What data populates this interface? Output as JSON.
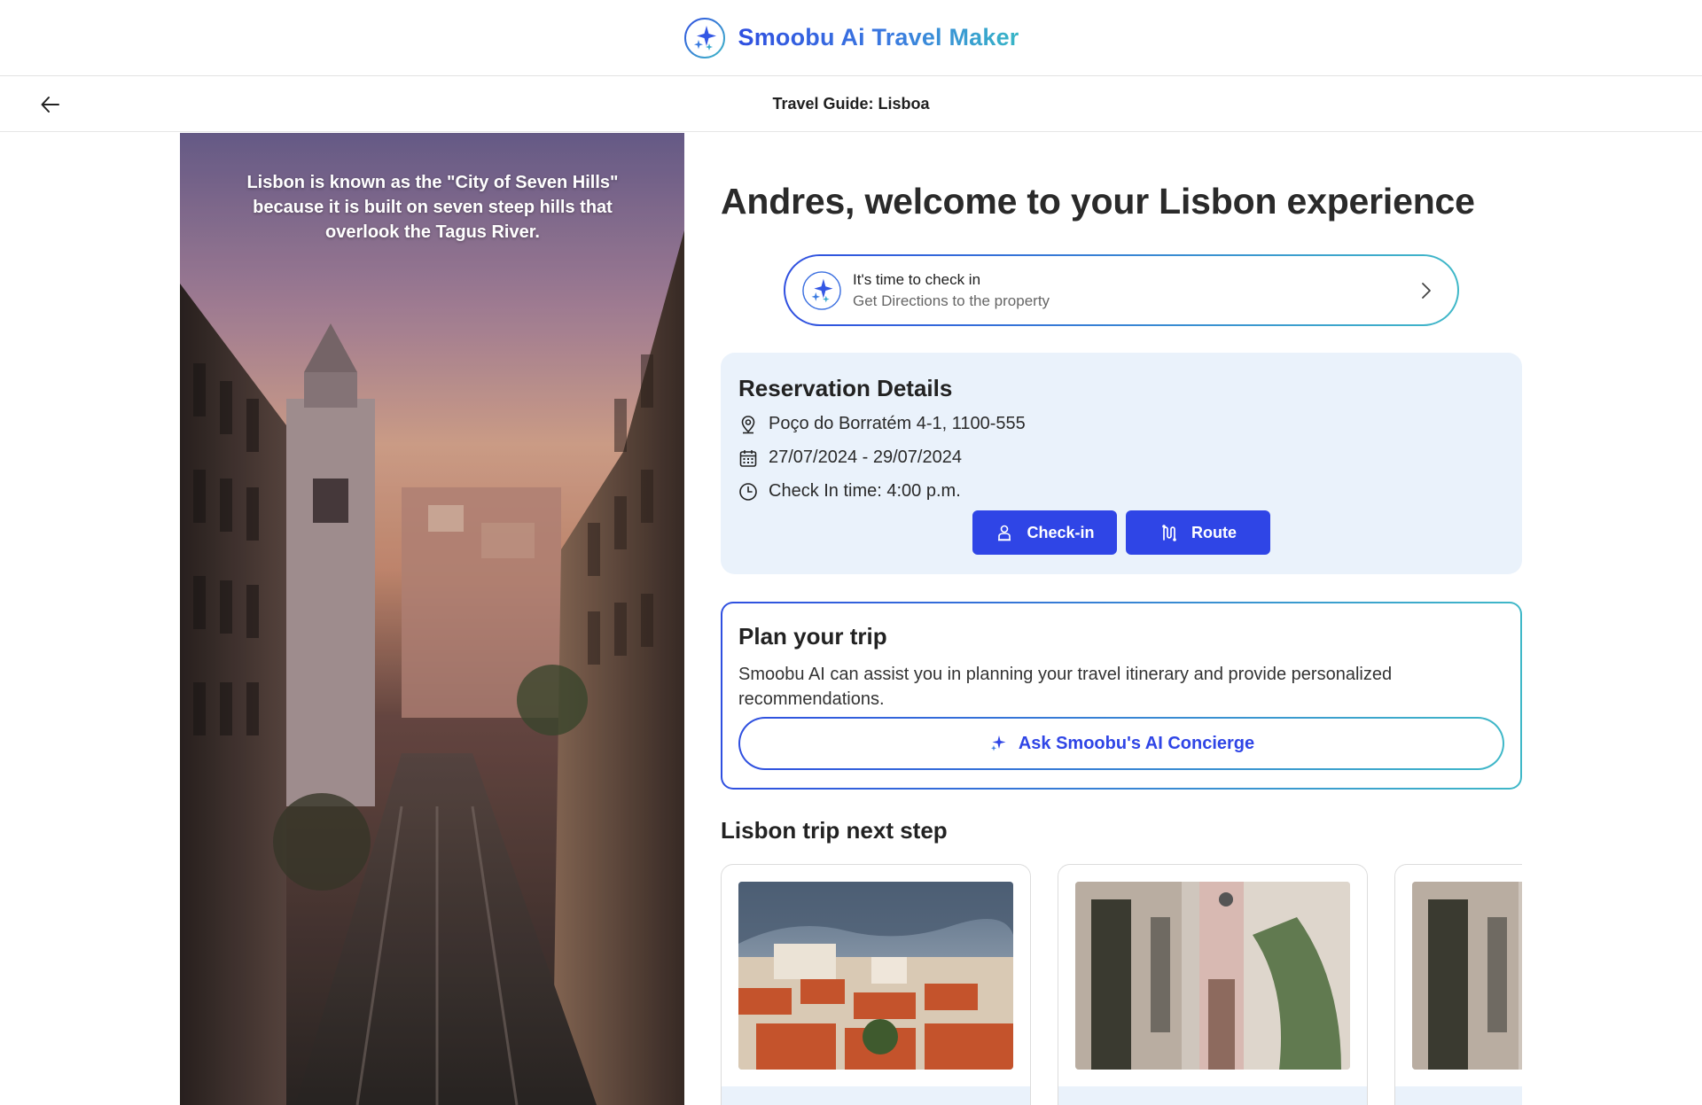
{
  "brand": {
    "name": "Smoobu Ai Travel Maker",
    "logo_icon": "sparkle-icon"
  },
  "subheader": {
    "title": "Travel Guide: Lisboa",
    "back_icon": "arrow-left-icon"
  },
  "hero": {
    "fact": "Lisbon is known as the \"City of Seven Hills\" because it is built on seven steep hills that overlook the Tagus River."
  },
  "welcome": {
    "title": "Andres, welcome to your Lisbon experience"
  },
  "checkin_banner": {
    "title": "It's time to check in",
    "subtitle": "Get Directions to the property"
  },
  "reservation": {
    "title": "Reservation Details",
    "address": "Poço do Borratém 4-1, 1100-555",
    "dates": "27/07/2024 - 29/07/2024",
    "checkin_time": "Check In time: 4:00 p.m.",
    "checkin_button": "Check-in",
    "route_button": "Route"
  },
  "plan": {
    "title": "Plan your trip",
    "description": "Smoobu AI can assist you in planning your travel itinerary and provide personalized recommendations.",
    "ask_button": "Ask Smoobu's AI Concierge"
  },
  "next_step": {
    "title": "Lisbon trip next step"
  },
  "colors": {
    "accent": "#2f45e6",
    "gradient_start": "#2f4fe0",
    "gradient_end": "#3fb8c8",
    "card_bg": "#eaf2fb"
  }
}
